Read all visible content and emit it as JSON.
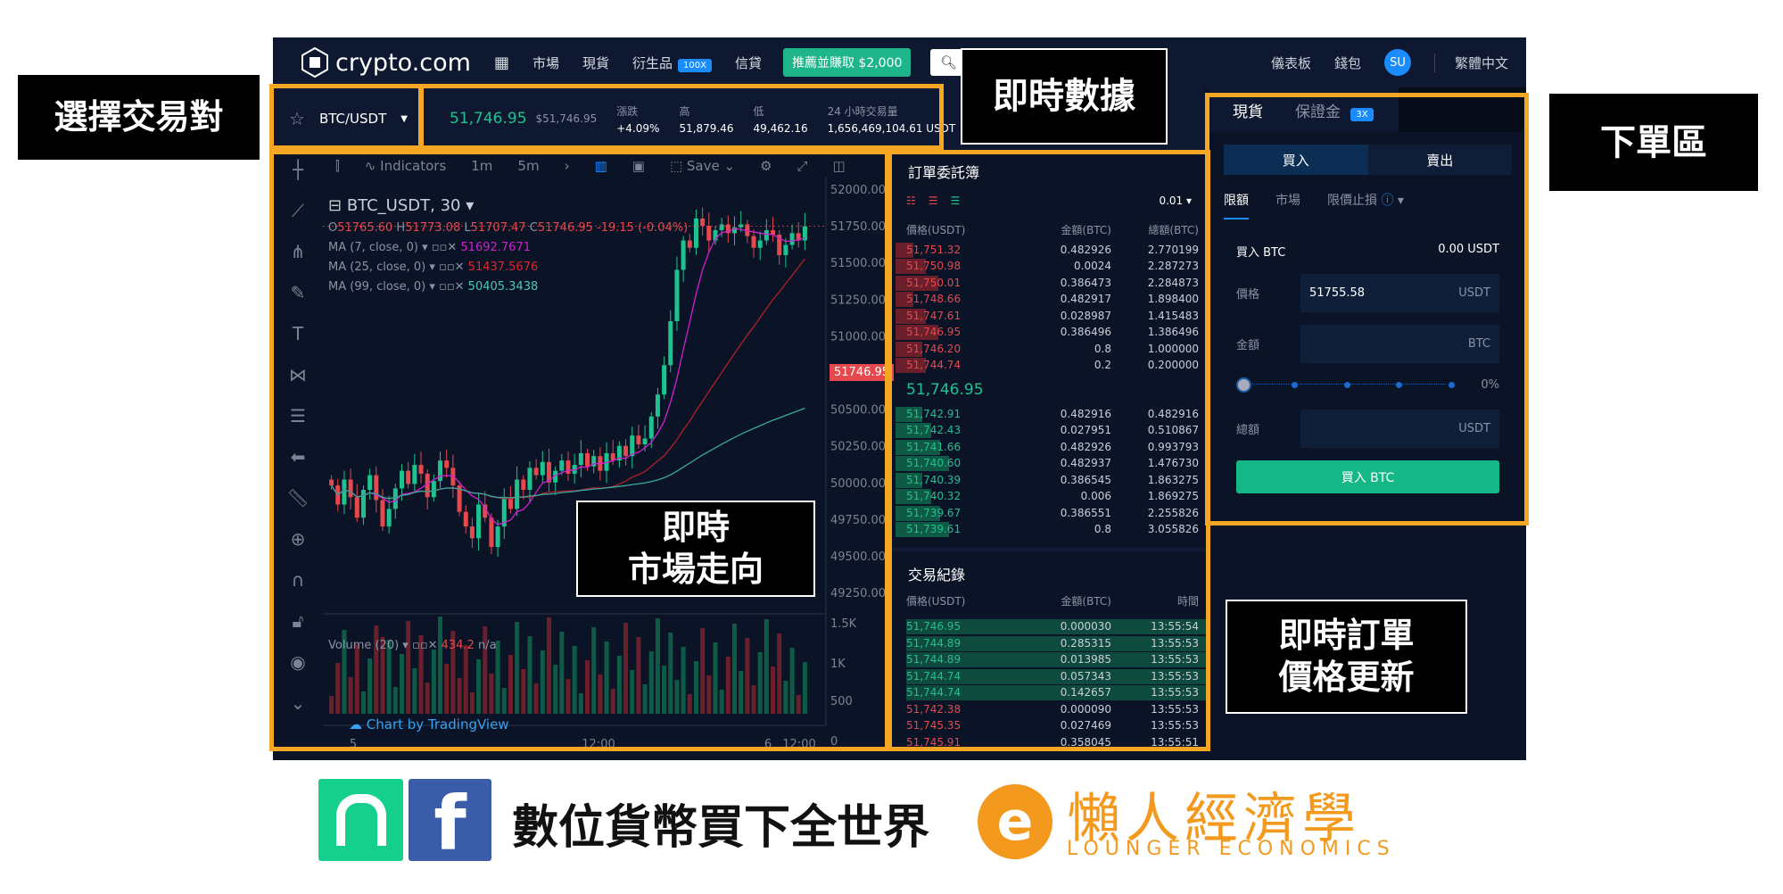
{
  "nav": {
    "brand": "crypto.com",
    "items": [
      "市場",
      "現貨",
      "衍生品",
      "信貸"
    ],
    "derivatives_badge": "100X",
    "promo": "推薦並賺取 $2,000",
    "right": [
      "儀表板",
      "錢包"
    ],
    "avatar": "SU",
    "language": "繁體中文"
  },
  "info": {
    "pair": "BTC/USDT",
    "last_price": "51,746.95",
    "last_price_usd": "$51,746.95",
    "change_label": "漲跌",
    "change": "+4.09%",
    "high_label": "高",
    "high": "51,879.46",
    "low_label": "低",
    "low": "49,462.16",
    "volume_label": "24 小時交易量",
    "volume": "1,656,469,104.61 USDT"
  },
  "chart": {
    "toolbar": [
      "Indicators",
      "1m",
      "5m",
      "Save"
    ],
    "symbol": "BTC_USDT, 30",
    "ohlc": {
      "o": "51765.60",
      "h": "51773.08",
      "l": "51707.47",
      "c": "51746.95",
      "chg": "-19.15 (-0.04%)"
    },
    "ma": [
      {
        "label": "MA (7, close, 0)",
        "value": "51692.7671",
        "color": "#d21fd2"
      },
      {
        "label": "MA (25, close, 0)",
        "value": "51437.5676",
        "color": "#e0262f"
      },
      {
        "label": "MA (99, close, 0)",
        "value": "50405.3438",
        "color": "#4cc6c0"
      }
    ],
    "volume": {
      "label": "Volume (20)",
      "value": "434.2",
      "na": "n/a"
    },
    "watermark": "Chart by TradingView",
    "price_tag": "51746.95",
    "price_ticks": [
      "52000.00",
      "51750.00",
      "51500.00",
      "51250.00",
      "51000.00",
      "50750.00",
      "50500.00",
      "50250.00",
      "50000.00",
      "49750.00",
      "49500.00",
      "49250.00"
    ],
    "volume_ticks": [
      "1.5K",
      "1K",
      "500",
      "0"
    ],
    "time_ticks": [
      "5",
      "12:00",
      "6",
      "12:00"
    ],
    "closes": [
      49980,
      49850,
      50020,
      49900,
      49760,
      49950,
      50050,
      49880,
      49700,
      49820,
      49960,
      50080,
      49990,
      50120,
      50060,
      49900,
      50010,
      50150,
      50100,
      49980,
      49800,
      49700,
      49620,
      49850,
      49760,
      49560,
      49700,
      49900,
      49820,
      50020,
      49950,
      50100,
      50050,
      50140,
      50000,
      50080,
      50150,
      50060,
      50120,
      50200,
      50110,
      50180,
      50080,
      50200,
      50150,
      50250,
      50180,
      50320,
      50260,
      50300,
      50450,
      50600,
      50800,
      51100,
      51450,
      51650,
      51600,
      51800,
      51750,
      51650,
      51720,
      51760,
      51700,
      51740,
      51760,
      51680,
      51600,
      51650,
      51720,
      51690,
      51550,
      51620,
      51700,
      51650,
      51746.95
    ]
  },
  "orderbook": {
    "title": "訂單委託簿",
    "precision": "0.01",
    "headers": [
      "價格(USDT)",
      "金額(BTC)",
      "總額(BTC)"
    ],
    "asks": [
      [
        "51,751.32",
        "0.482926",
        "2.770199"
      ],
      [
        "51,750.98",
        "0.0024",
        "2.287273"
      ],
      [
        "51,750.01",
        "0.386473",
        "2.284873"
      ],
      [
        "51,748.66",
        "0.482917",
        "1.898400"
      ],
      [
        "51,747.61",
        "0.028987",
        "1.415483"
      ],
      [
        "51,746.95",
        "0.386496",
        "1.386496"
      ],
      [
        "51,746.20",
        "0.8",
        "1.000000"
      ],
      [
        "51,744.74",
        "0.2",
        "0.200000"
      ]
    ],
    "mid": "51,746.95",
    "bids": [
      [
        "51,742.91",
        "0.482916",
        "0.482916"
      ],
      [
        "51,742.43",
        "0.027951",
        "0.510867"
      ],
      [
        "51,741.66",
        "0.482926",
        "0.993793"
      ],
      [
        "51,740.60",
        "0.482937",
        "1.476730"
      ],
      [
        "51,740.39",
        "0.386545",
        "1.863275"
      ],
      [
        "51,740.32",
        "0.006",
        "1.869275"
      ],
      [
        "51,739.67",
        "0.386551",
        "2.255826"
      ],
      [
        "51,739.61",
        "0.8",
        "3.055826"
      ]
    ]
  },
  "trades": {
    "title": "交易紀錄",
    "headers": [
      "價格(USDT)",
      "金額(BTC)",
      "時間"
    ],
    "rows": [
      [
        "51,746.95",
        "0.000030",
        "13:55:54",
        "buy"
      ],
      [
        "51,744.89",
        "0.285315",
        "13:55:53",
        "buy"
      ],
      [
        "51,744.89",
        "0.013985",
        "13:55:53",
        "buy"
      ],
      [
        "51,744.74",
        "0.057343",
        "13:55:53",
        "buy"
      ],
      [
        "51,744.74",
        "0.142657",
        "13:55:53",
        "buy"
      ],
      [
        "51,742.38",
        "0.000090",
        "13:55:53",
        "sell"
      ],
      [
        "51,745.35",
        "0.027469",
        "13:55:53",
        "sell"
      ],
      [
        "51,745.91",
        "0.358045",
        "13:55:51",
        "sell"
      ]
    ]
  },
  "order": {
    "tab_spot": "現貨",
    "tab_margin": "保證金",
    "margin_badge": "3X",
    "buy": "買入",
    "sell": "賣出",
    "types": [
      "限額",
      "市場",
      "限價止損"
    ],
    "buy_btc": "買入 BTC",
    "balance": "0.00 USDT",
    "price_label": "價格",
    "price_value": "51755.58",
    "price_unit": "USDT",
    "amount_label": "金額",
    "amount_unit": "BTC",
    "slider_pct": "0%",
    "total_label": "總額",
    "total_unit": "USDT",
    "submit": "買入 BTC"
  },
  "annotations": {
    "pair": "選擇交易對",
    "realtime": "即時數據",
    "order_area": "下單區",
    "market_l1": "即時",
    "market_l2": "市場走向",
    "book_l1": "即時訂單",
    "book_l2": "價格更新"
  },
  "banner": {
    "text": "數位貨幣買下全世界",
    "logo_cn": "懶人經濟學",
    "logo_en": "LOUNGER ECONOMICS"
  },
  "colors": {
    "accent_orange": "#f5a623",
    "buy_green": "#13b886",
    "sell_red": "#e5484d",
    "bg": "#0b1426"
  }
}
